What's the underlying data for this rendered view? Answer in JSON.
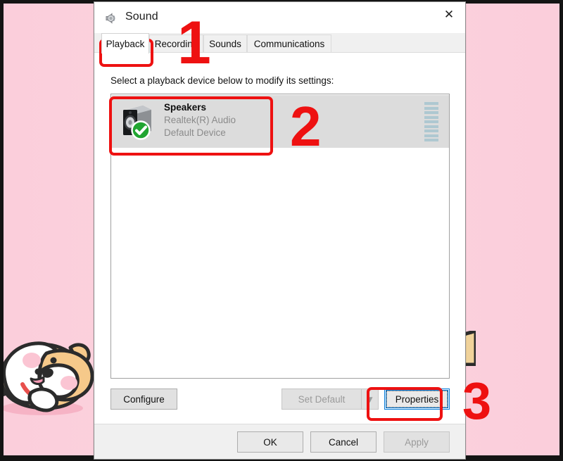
{
  "wallpaper": {
    "bg_color": "#fbcedb",
    "frame_color": "#141414",
    "mascot": "shiba-inu-dog-illustration"
  },
  "dialog": {
    "title": "Sound",
    "title_icon": "speaker-icon",
    "close_label": "✕",
    "tabs": [
      {
        "label": "Playback",
        "active": true
      },
      {
        "label": "Recording",
        "active": false
      },
      {
        "label": "Sounds",
        "active": false
      },
      {
        "label": "Communications",
        "active": false
      }
    ],
    "hint": "Select a playback device below to modify its settings:",
    "devices": [
      {
        "name": "Speakers",
        "driver": "Realtek(R) Audio",
        "status": "Default Device",
        "icon": "speaker-box-icon",
        "badge": "green-check-badge",
        "selected": true,
        "meter_segments": 9
      }
    ],
    "buttons": {
      "configure": "Configure",
      "set_default": "Set Default",
      "set_default_arrow": "▼",
      "properties": "Properties",
      "ok": "OK",
      "cancel": "Cancel",
      "apply": "Apply"
    }
  },
  "annotations": {
    "accent_color": "#ee1111",
    "steps": [
      {
        "number": "1",
        "target": "playback-tab"
      },
      {
        "number": "2",
        "target": "speakers-device-row"
      },
      {
        "number": "3",
        "target": "properties-button"
      }
    ]
  }
}
